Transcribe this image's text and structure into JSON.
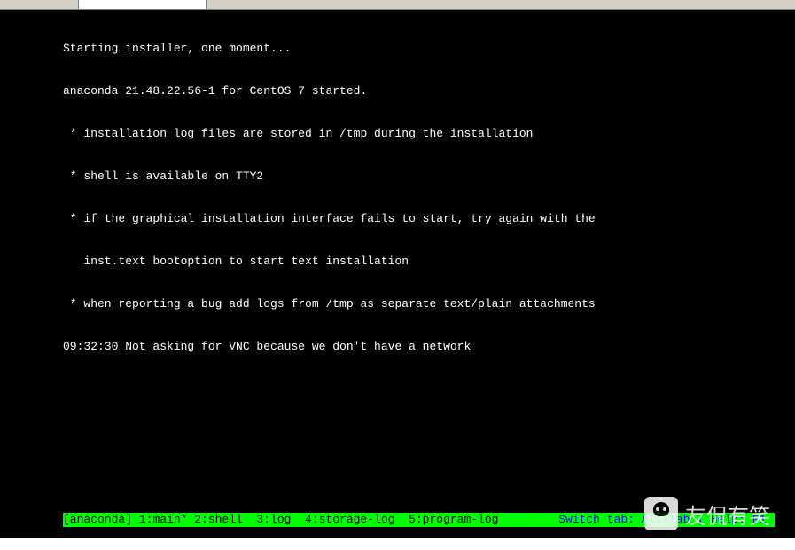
{
  "terminal": {
    "lines": [
      "Starting installer, one moment...",
      "anaconda 21.48.22.56-1 for CentOS 7 started.",
      " * installation log files are stored in /tmp during the installation",
      " * shell is available on TTY2",
      " * if the graphical installation interface fails to start, try again with the",
      "   inst.text bootoption to start text installation",
      " * when reporting a bug add logs from /tmp as separate text/plain attachments",
      "09:32:30 Not asking for VNC because we don't have a network"
    ]
  },
  "statusbar": {
    "left": "[anaconda] 1:main* 2:shell  3:log  4:storage-log  5:program-log",
    "right": "Switch tab: Alt+Tab | Help: F1 "
  },
  "watermark": {
    "text": "友侃有笑"
  }
}
